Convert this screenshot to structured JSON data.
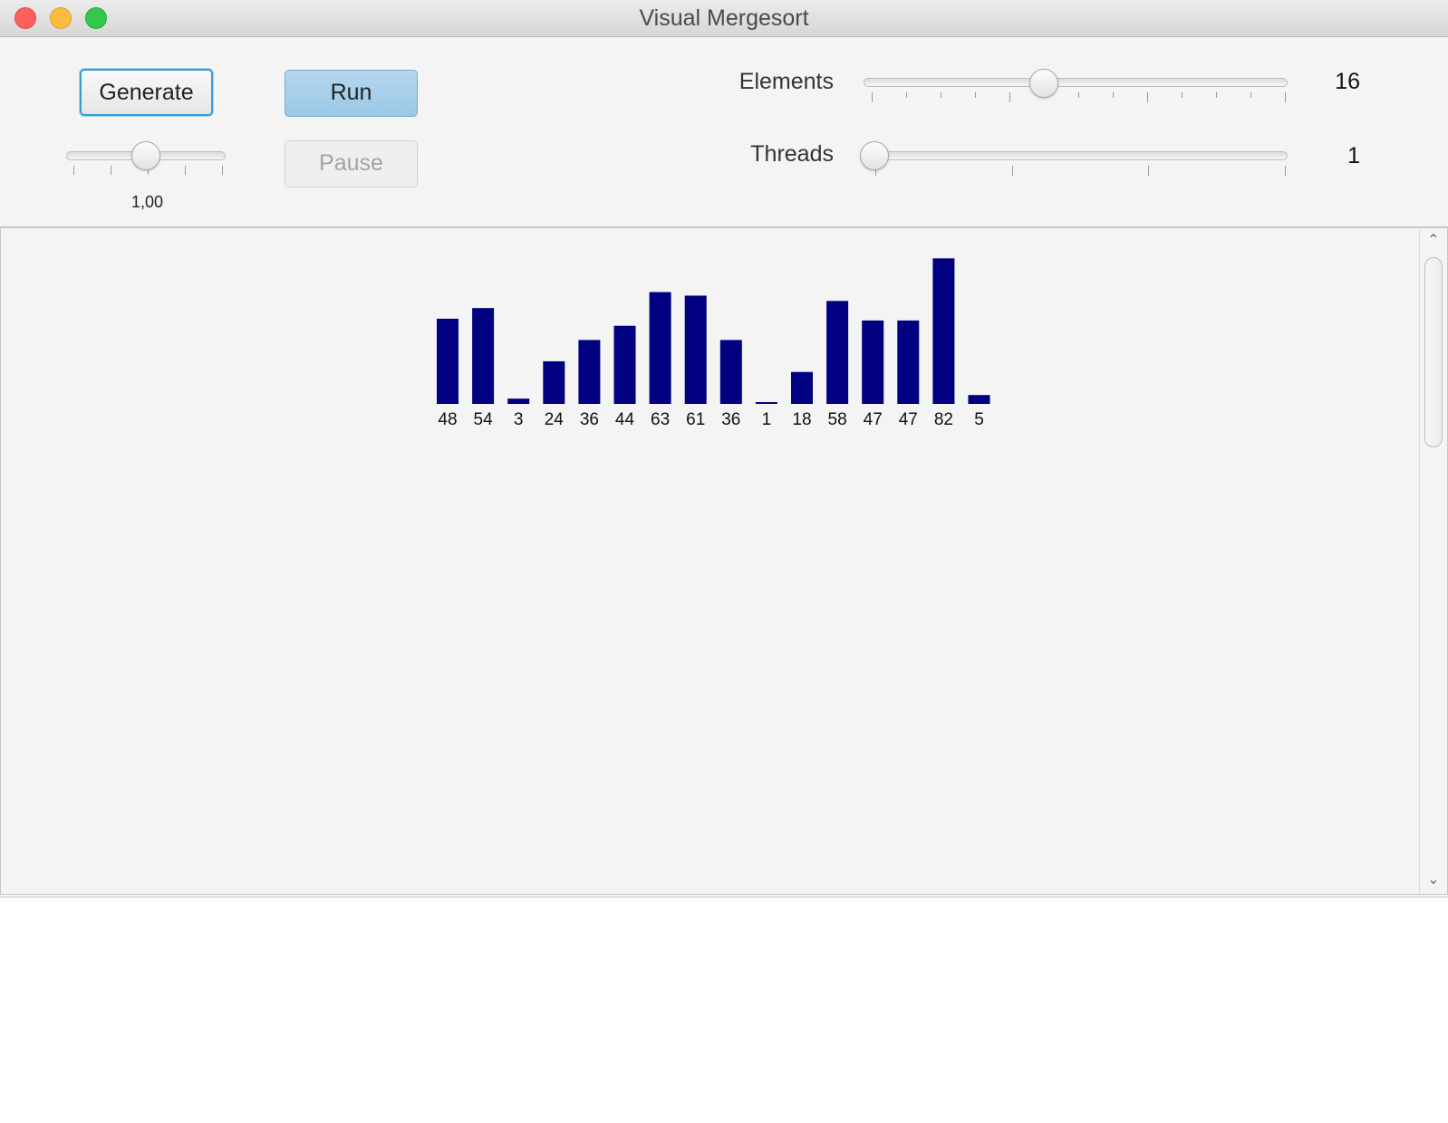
{
  "window": {
    "title": "Visual Mergesort"
  },
  "toolbar": {
    "generate_label": "Generate",
    "run_label": "Run",
    "pause_label": "Pause",
    "speed": {
      "value_label": "1,00",
      "level": 0.5
    },
    "elements": {
      "label": "Elements",
      "value": "16",
      "level": 0.42
    },
    "threads": {
      "label": "Threads",
      "value": "1",
      "level": 0.0
    }
  },
  "colors": {
    "bar": "#000080",
    "accent": "#3a9bd9",
    "run_button": "#a5cfea"
  },
  "chart_data": {
    "type": "bar",
    "categories": [
      "48",
      "54",
      "3",
      "24",
      "36",
      "44",
      "63",
      "61",
      "36",
      "1",
      "18",
      "58",
      "47",
      "47",
      "82",
      "5"
    ],
    "values": [
      48,
      54,
      3,
      24,
      36,
      44,
      63,
      61,
      36,
      1,
      18,
      58,
      47,
      47,
      82,
      5
    ],
    "title": "",
    "xlabel": "",
    "ylabel": "",
    "grid": false
  }
}
